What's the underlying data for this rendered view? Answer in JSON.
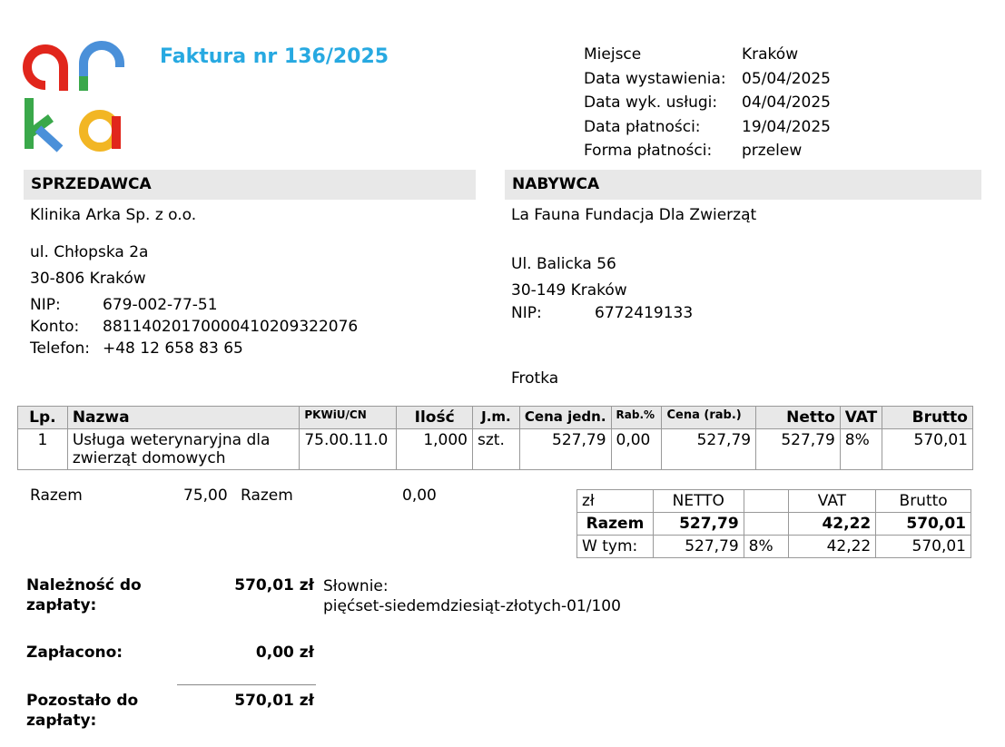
{
  "logo": {
    "text": "arka",
    "colors": [
      "#e1261c",
      "#4a90d9",
      "#3aa84a",
      "#f2b624"
    ]
  },
  "invoice": {
    "title": "Faktura nr 136/2025"
  },
  "meta": [
    {
      "label": "Miejsce",
      "value": "Kraków"
    },
    {
      "label": "Data wystawienia:",
      "value": "05/04/2025"
    },
    {
      "label": "Data wyk. usługi:",
      "value": "04/04/2025"
    },
    {
      "label": "Data płatności:",
      "value": "19/04/2025"
    },
    {
      "label": "Forma płatności:",
      "value": "przelew"
    }
  ],
  "seller": {
    "header": "SPRZEDAWCA",
    "name": "Klinika Arka Sp. z o.o.",
    "street": "ul. Chłopska 2a",
    "city": "30-806 Kraków",
    "nip_label": "NIP:",
    "nip": "679-002-77-51",
    "konto_label": "Konto:",
    "konto": "88114020170000410209322076",
    "tel_label": "Telefon:",
    "tel": "+48 12 658 83 65"
  },
  "buyer": {
    "header": "NABYWCA",
    "name": "La Fauna Fundacja Dla Zwierząt",
    "street": "Ul. Balicka 56",
    "city": "30-149 Kraków",
    "nip_label": "NIP:",
    "nip": "6772419133",
    "note": "Frotka"
  },
  "items": {
    "headers": [
      "Lp.",
      "Nazwa",
      "PKWiU/CN",
      "Ilość",
      "J.m.",
      "Cena jedn.",
      "Rab.%",
      "Cena (rab.)",
      "Netto",
      "VAT",
      "Brutto"
    ],
    "rows": [
      {
        "lp": "1",
        "name": "Usługa weterynaryjna dla zwierząt domowych",
        "pkwiu": "75.00.11.0",
        "qty": "1,000",
        "unit": "szt.",
        "price": "527,79",
        "rab": "0,00",
        "price_rab": "527,79",
        "netto": "527,79",
        "vat": "8%",
        "brutto": "570,01"
      }
    ]
  },
  "razem_left": {
    "label1": "Razem",
    "value1": "75,00",
    "label2": "Razem",
    "value2": "0,00"
  },
  "summary": {
    "headers": [
      "zł",
      "NETTO",
      "",
      "VAT",
      "Brutto"
    ],
    "total": {
      "label": "Razem",
      "netto": "527,79",
      "vat": "42,22",
      "brutto": "570,01"
    },
    "breakdown": {
      "label": "W tym:",
      "netto": "527,79",
      "rate": "8%",
      "vat": "42,22",
      "brutto": "570,01"
    }
  },
  "payment": {
    "due_label": "Należność do zapłaty:",
    "due_value": "570,01 zł",
    "words_label": "Słownie:",
    "words": "pięćset-siedemdziesiąt-złotych-01/100",
    "paid_label": "Zapłacono:",
    "paid_value": "0,00 zł",
    "remaining_label": "Pozostało do zapłaty:",
    "remaining_value": "570,01 zł"
  }
}
